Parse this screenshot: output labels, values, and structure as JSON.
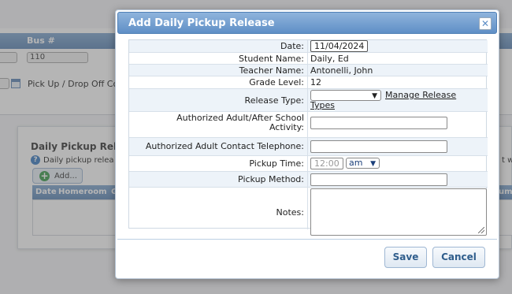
{
  "background": {
    "header": {
      "col1": "",
      "bus_label": "Bus #"
    },
    "bus_value": "110",
    "pickup_text": "Pick Up / Drop Off Co",
    "section_title": "Daily Pickup Rele",
    "help_text": "Daily pickup relea",
    "help_text_right": "t w",
    "add_label": "Add...",
    "table_headers": [
      "Date",
      "Homeroom",
      "G"
    ],
    "table_header_right": "um"
  },
  "dialog": {
    "title": "Add Daily Pickup Release",
    "close_glyph": "✕",
    "fields": {
      "date": {
        "label": "Date:",
        "value": "11/04/2024"
      },
      "student_name": {
        "label": "Student Name:",
        "value": "Daily, Ed"
      },
      "teacher_name": {
        "label": "Teacher Name:",
        "value": "Antonelli, John"
      },
      "grade_level": {
        "label": "Grade Level:",
        "value": "12"
      },
      "release_type": {
        "label": "Release Type:",
        "value": "",
        "link_line1": "Manage Release",
        "link_line2": "Types"
      },
      "authorized_adult": {
        "label_line1": "Authorized Adult/After School",
        "label_line2": "Activity:",
        "value": ""
      },
      "contact_telephone": {
        "label": "Authorized Adult Contact Telephone:",
        "value": ""
      },
      "pickup_time": {
        "label": "Pickup Time:",
        "placeholder": "12:00",
        "ampm": "am"
      },
      "pickup_method": {
        "label": "Pickup Method:",
        "value": ""
      },
      "notes": {
        "label": "Notes:",
        "value": ""
      }
    },
    "buttons": {
      "save": "Save",
      "cancel": "Cancel"
    }
  }
}
